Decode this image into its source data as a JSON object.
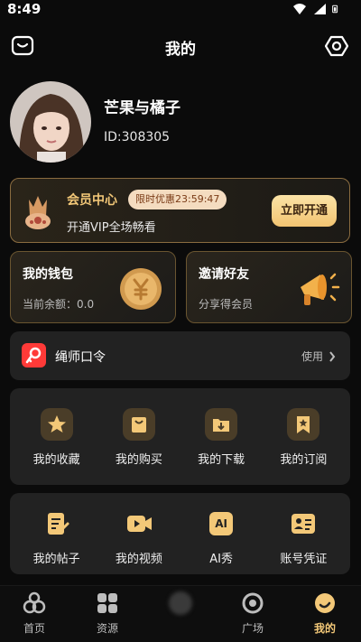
{
  "status": {
    "time": "8:49"
  },
  "header": {
    "title": "我的",
    "left_icon": "message-box-icon",
    "right_icon": "settings-hexagon-icon"
  },
  "profile": {
    "username": "芒果与橘子",
    "user_id": "ID:308305"
  },
  "vip": {
    "title": "会员中心",
    "badge": "限时优惠23:59:47",
    "subtitle": "开通VIP全场畅看",
    "button": "立即开通"
  },
  "wallet": {
    "title": "我的钱包",
    "balance": "当前余额：0.0"
  },
  "invite": {
    "title": "邀请好友",
    "subtitle": "分享得会员"
  },
  "password": {
    "label": "绳师口令",
    "action": "使用"
  },
  "grid1": [
    {
      "label": "我的收藏",
      "icon": "star-icon"
    },
    {
      "label": "我的购买",
      "icon": "shopping-bag-icon"
    },
    {
      "label": "我的下载",
      "icon": "download-icon"
    },
    {
      "label": "我的订阅",
      "icon": "bookmark-icon"
    }
  ],
  "grid2": [
    {
      "label": "我的帖子",
      "icon": "post-edit-icon"
    },
    {
      "label": "我的视频",
      "icon": "video-icon"
    },
    {
      "label": "AI秀",
      "icon": "ai-icon",
      "glyph": "AI"
    },
    {
      "label": "账号凭证",
      "icon": "id-card-icon"
    }
  ],
  "tabs": [
    {
      "label": "首页",
      "icon": "home-icon"
    },
    {
      "label": "资源",
      "icon": "grid-icon"
    },
    {
      "label": "",
      "icon": "blurred-icon"
    },
    {
      "label": "广场",
      "icon": "target-icon"
    },
    {
      "label": "我的",
      "icon": "profile-icon",
      "active": true
    }
  ],
  "colors": {
    "accent": "#f3c878",
    "card": "#222222",
    "background": "#0b0b0b",
    "red": "#ff3a38"
  }
}
